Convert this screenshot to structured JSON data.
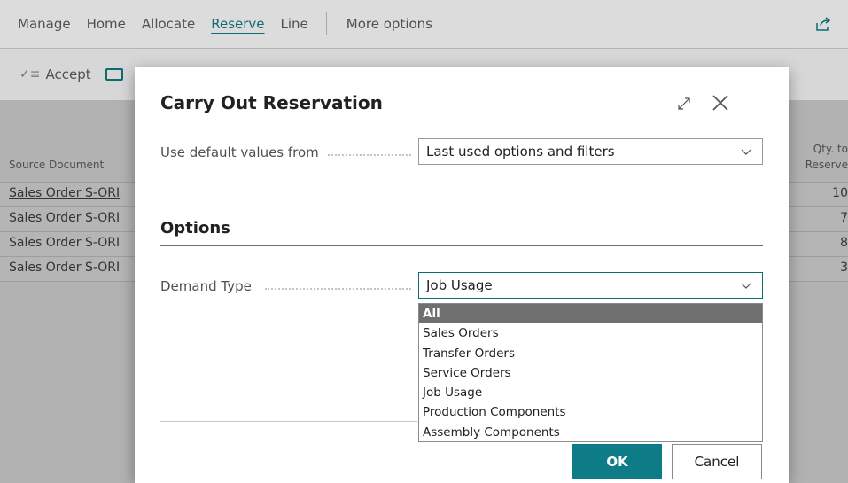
{
  "menu": {
    "items": [
      {
        "label": "Manage",
        "active": false
      },
      {
        "label": "Home",
        "active": false
      },
      {
        "label": "Allocate",
        "active": false
      },
      {
        "label": "Reserve",
        "active": true
      },
      {
        "label": "Line",
        "active": false
      }
    ],
    "more_options": "More options",
    "share_icon": "share-icon"
  },
  "actions": {
    "accept_label": "Accept",
    "accept_icon": "checklist-icon"
  },
  "grid": {
    "col_source": "Source Document",
    "col_qty": "Qty. to Reserve",
    "rows": [
      {
        "source": "Sales Order S-ORI",
        "qty": "10"
      },
      {
        "source": "Sales Order S-ORI",
        "qty": "7"
      },
      {
        "source": "Sales Order S-ORI",
        "qty": "8"
      },
      {
        "source": "Sales Order S-ORI",
        "qty": "3"
      }
    ]
  },
  "dialog": {
    "title": "Carry Out Reservation",
    "default_values_label": "Use default values from",
    "default_values_value": "Last used options and filters",
    "options_section": "Options",
    "demand_type_label": "Demand Type",
    "demand_type_value": "Job Usage",
    "demand_type_options": [
      "All",
      "Sales Orders",
      "Transfer Orders",
      "Service Orders",
      "Job Usage",
      "Production Components",
      "Assembly Components"
    ],
    "highlighted_option": "All",
    "ok_label": "OK",
    "cancel_label": "Cancel"
  },
  "colors": {
    "accent": "#0e7c86",
    "highlight": "#6f6f6f"
  }
}
